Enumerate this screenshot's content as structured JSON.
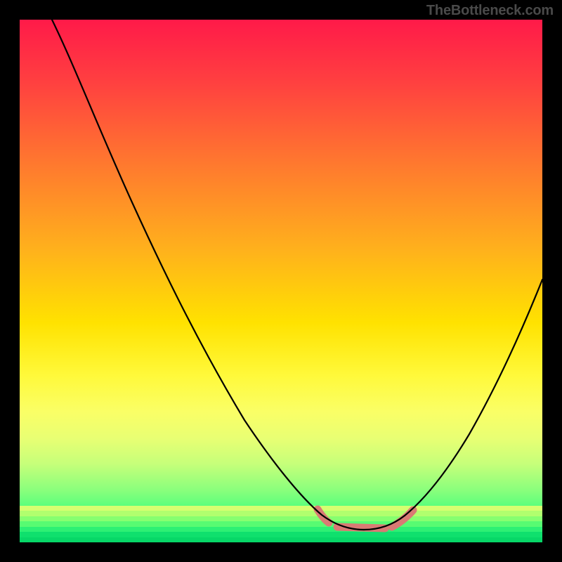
{
  "watermark_text": "TheBottleneck.com",
  "colors": {
    "frame": "#000000",
    "watermark": "#4a4a4a",
    "curve_main": "#000000",
    "curve_bottom": "#d97a74",
    "gradient_stops": [
      "#ff1a49",
      "#ff4040",
      "#ff7a2e",
      "#ffb11c",
      "#ffe200",
      "#fff93a",
      "#faff66",
      "#e9ff73",
      "#c6ff7a",
      "#8aff7c",
      "#3eff7d",
      "#08e56b"
    ]
  },
  "chart_data": {
    "type": "line",
    "title": "",
    "xlabel": "",
    "ylabel": "",
    "xlim": [
      0,
      100
    ],
    "ylim": [
      0,
      100
    ],
    "grid": false,
    "legend": false,
    "series": [
      {
        "name": "bottleneck-curve",
        "x": [
          6,
          12,
          20,
          30,
          40,
          50,
          55,
          58,
          60,
          64,
          68,
          72,
          76,
          80,
          86,
          92,
          100
        ],
        "y": [
          100,
          88,
          73,
          55,
          37,
          19,
          10,
          5,
          3,
          2,
          2,
          3,
          6,
          12,
          24,
          38,
          56
        ]
      },
      {
        "name": "optimal-flat-region",
        "x": [
          57,
          60,
          64,
          68,
          72,
          75
        ],
        "y": [
          3,
          2,
          2,
          2,
          3,
          5
        ]
      }
    ],
    "annotations": []
  }
}
